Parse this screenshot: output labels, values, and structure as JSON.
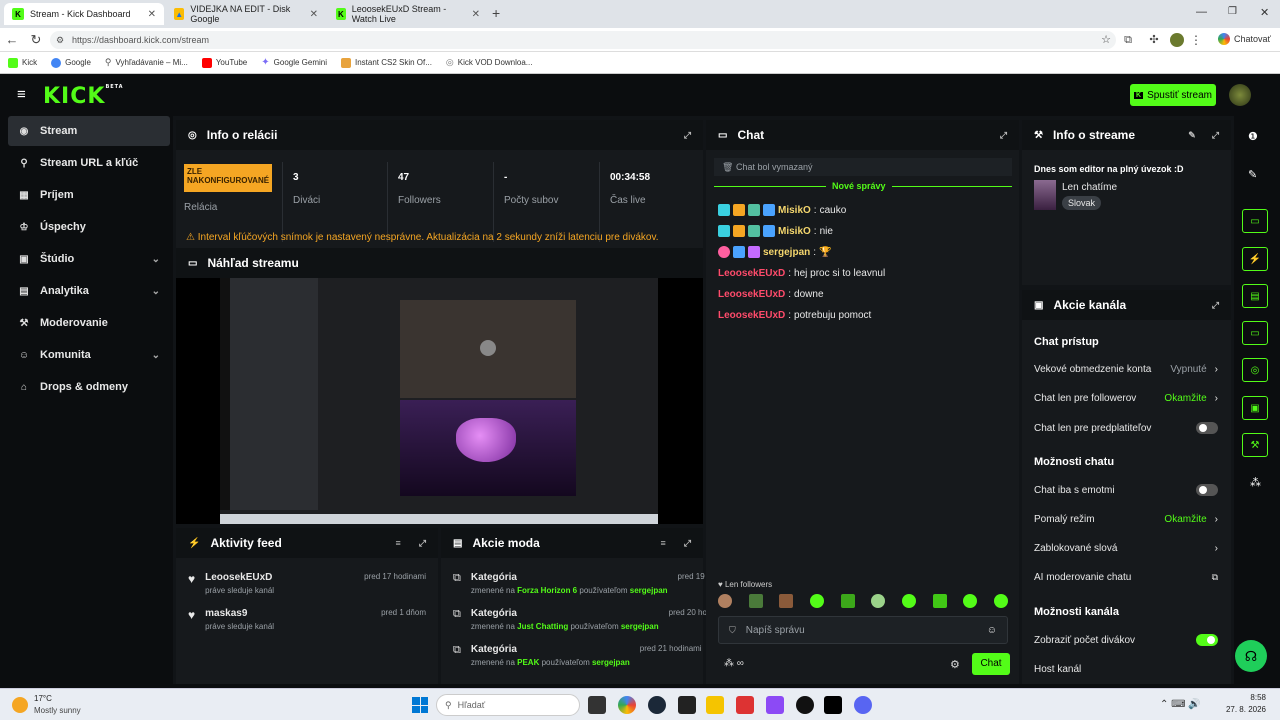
{
  "browser": {
    "tabs": [
      {
        "title": "Stream - Kick Dashboard",
        "fav_color": "#53fc18",
        "fav_letter": "K"
      },
      {
        "title": "VIDEJKA NA EDIT - Disk Google",
        "fav_color": "#34a853",
        "fav_letter": "▲"
      },
      {
        "title": "LeoosekEUxD Stream - Watch Live",
        "fav_color": "#53fc18",
        "fav_letter": "K"
      }
    ],
    "url": "https://dashboard.kick.com/stream",
    "profile_label": "Chatovať",
    "bookmarks": [
      {
        "label": "Kick",
        "color": "#53fc18"
      },
      {
        "label": "Google",
        "color": "#4285f4"
      },
      {
        "label": "Vyhľadávanie – Mi...",
        "color": "#888888"
      },
      {
        "label": "YouTube",
        "color": "#ff0000"
      },
      {
        "label": "Google Gemini",
        "color": "#7b6cf6"
      },
      {
        "label": "Instant CS2 Skin Of...",
        "color": "#e8a33d"
      },
      {
        "label": "Kick VOD Downloa...",
        "color": "#999999"
      }
    ]
  },
  "app": {
    "logo": "KICK",
    "logo_sup": "BETA",
    "start_button": "Spustiť stream",
    "sidebar": [
      {
        "label": "Stream",
        "icon": "◉",
        "active": true,
        "chevron": false
      },
      {
        "label": "Stream URL a kľúč",
        "icon": "⚲",
        "active": false,
        "chevron": false
      },
      {
        "label": "Príjem",
        "icon": "▦",
        "active": false,
        "chevron": false
      },
      {
        "label": "Úspechy",
        "icon": "♔",
        "active": false,
        "chevron": false
      },
      {
        "label": "Štúdio",
        "icon": "▣",
        "active": false,
        "chevron": true
      },
      {
        "label": "Analytika",
        "icon": "▤",
        "active": false,
        "chevron": true
      },
      {
        "label": "Moderovanie",
        "icon": "⚒",
        "active": false,
        "chevron": false
      },
      {
        "label": "Komunita",
        "icon": "☺",
        "active": false,
        "chevron": true
      },
      {
        "label": "Drops & odmeny",
        "icon": "⌂",
        "active": false,
        "chevron": false
      }
    ],
    "session": {
      "title": "Info o relácii",
      "status_badge": "ZLE NAKONFIGUROVANÉ",
      "status_label": "Relácia",
      "stats": [
        {
          "value": "3",
          "label": "Diváci"
        },
        {
          "value": "47",
          "label": "Followers"
        },
        {
          "value": "-",
          "label": "Počty subov"
        },
        {
          "value": "00:34:58",
          "label": "Čas live"
        }
      ],
      "warning": "Interval kľúčových snímok je nastavený nesprávne. Aktualizácia na 2 sekundy zníži latenciu pre divákov."
    },
    "preview": {
      "title": "Náhľad streamu"
    },
    "activity": {
      "title": "Aktivity feed",
      "items": [
        {
          "user": "LeoosekEUxD",
          "text": "práve sleduje kanál",
          "time": "pred 17 hodinami"
        },
        {
          "user": "maskas9",
          "text": "práve sleduje kanál",
          "time": "pred 1 dňom"
        }
      ]
    },
    "mod_actions": {
      "title": "Akcie moda",
      "items": [
        {
          "title": "Kategória",
          "prefix": "zmenené na",
          "game": "Forza Horizon 6",
          "mid": "používateľom",
          "user": "sergejpan",
          "time": "pred 19 hodinami"
        },
        {
          "title": "Kategória",
          "prefix": "zmenené na",
          "game": "Just Chatting",
          "mid": "používateľom",
          "user": "sergejpan",
          "time": "pred 20 hodinami"
        },
        {
          "title": "Kategória",
          "prefix": "zmenené na",
          "game": "PEAK",
          "mid": "používateľom",
          "user": "sergejpan",
          "time": "pred 21 hodinami"
        }
      ]
    },
    "chat": {
      "title": "Chat",
      "cleared": "Chat bol vymazaný",
      "new_messages": "Nové správy",
      "messages": [
        {
          "user": "MisikO",
          "text": "cauko",
          "color": "#f5d76e",
          "badges": 4
        },
        {
          "user": "MisikO",
          "text": "nie",
          "color": "#f5d76e",
          "badges": 4
        },
        {
          "user": "sergejpan",
          "text": "🏆",
          "color": "#f5d76e",
          "badges": 3
        },
        {
          "user": "LeoosekEUxD",
          "text": "hej proc si to leavnul",
          "color": "#ff4b6b",
          "badges": 0
        },
        {
          "user": "LeoosekEUxD",
          "text": "downe",
          "color": "#ff4b6b",
          "badges": 0
        },
        {
          "user": "LeoosekEUxD",
          "text": "potrebuju pomoct",
          "color": "#ff4b6b",
          "badges": 0
        }
      ],
      "followers_only": "Len followers",
      "input_placeholder": "Napíš správu",
      "send_button": "Chat"
    },
    "stream_info": {
      "title": "Info o streame",
      "stream_title": "Dnes som editor na plný úvezok :D",
      "category": "Len chatíme",
      "language": "Slovak"
    },
    "channel_actions": {
      "title": "Akcie kanála",
      "chat_access_title": "Chat prístup",
      "age_label": "Vekové obmedzenie konta",
      "age_value": "Vypnuté",
      "followers_label": "Chat len pre followerov",
      "followers_value": "Okamžite",
      "subs_label": "Chat len pre predplatiteľov",
      "chat_options_title": "Možnosti chatu",
      "emotes_label": "Chat iba s emotmi",
      "slow_label": "Pomalý režim",
      "slow_value": "Okamžite",
      "blocked_label": "Zablokované slová",
      "ai_label": "AI moderovanie chatu",
      "channel_options_title": "Možnosti kanála",
      "viewer_count_label": "Zobraziť počet divákov",
      "host_label": "Host kanál"
    }
  },
  "taskbar": {
    "weather_temp": "17°C",
    "weather_desc": "Mostly sunny",
    "search_placeholder": "Hľadať",
    "time": "8:58",
    "date": "27. 8. 2026"
  }
}
